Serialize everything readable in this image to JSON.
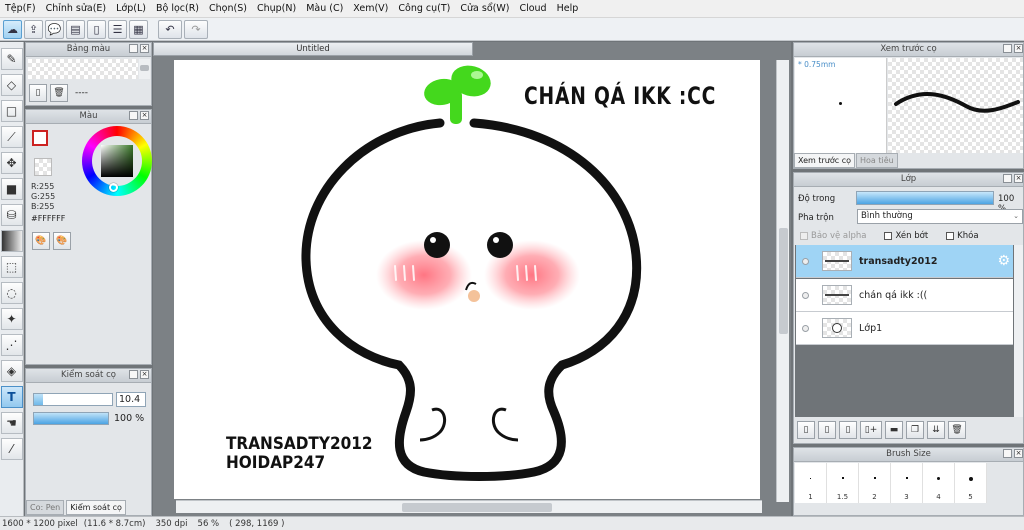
{
  "menu": [
    "Tệp(F)",
    "Chỉnh sửa(E)",
    "Lớp(L)",
    "Bộ lọc(R)",
    "Chọn(S)",
    "Chụp(N)",
    "Màu (C)",
    "Xem(V)",
    "Công cụ(T)",
    "Cửa sổ(W)",
    "Cloud",
    "Help"
  ],
  "toolbar_icons": [
    "cloud-icon",
    "export-icon",
    "comment-icon",
    "gallery-icon",
    "page-icon",
    "layout-icon",
    "grid-icon",
    "undo-icon",
    "redo-icon"
  ],
  "tools": [
    "brush-icon",
    "eraser-icon",
    "rectangle-icon",
    "line-icon",
    "move-icon",
    "fill-shape-icon",
    "bucket-icon",
    "gradient-icon",
    "select-rect-icon",
    "lasso-icon",
    "magic-wand-icon",
    "select-pen-icon",
    "select-eraser-icon",
    "text-icon",
    "hand-icon",
    "eyedropper-icon"
  ],
  "palette_panel": {
    "title": "Bảng màu",
    "info": "----"
  },
  "color_panel": {
    "title": "Màu",
    "primary": "#cc2222",
    "r": "R:255",
    "g": "G:255",
    "b": "B:255",
    "hex": "#FFFFFF"
  },
  "control_panel": {
    "title": "Kiểm soát cọ",
    "size_value": "10.4",
    "size_fraction": 0.12,
    "opacity_value": "100 %",
    "opacity_fraction": 1.0,
    "tabs": [
      "Co: Pen",
      "Kiểm soát cọ"
    ]
  },
  "document": {
    "tab_title": "Untitled",
    "heading_text": "CHÁN QÁ IKK :CC",
    "credit_line1": "TRANSADTY2012",
    "credit_line2": "HOIDAP247"
  },
  "preview_panel": {
    "title": "Xem trước cọ",
    "size_label": "* 0.75mm",
    "tabs": [
      "Xem trước cọ",
      "Hoa tiêu"
    ]
  },
  "layer_panel": {
    "title": "Lớp",
    "opacity_label": "Độ trong",
    "opacity_value": "100 %",
    "opacity_fraction": 1.0,
    "blend_label": "Pha trộn",
    "blend_value": "Bình thường",
    "protect_alpha": "Bảo vệ alpha",
    "clipping": "Xén bớt",
    "lock": "Khóa",
    "layers": [
      {
        "name": "transadty2012",
        "selected": true
      },
      {
        "name": "chán qá ikk :((",
        "selected": false
      },
      {
        "name": "Lớp1",
        "selected": false
      }
    ]
  },
  "brush_size_panel": {
    "title": "Brush Size",
    "sizes": [
      "1",
      "1.5",
      "2",
      "3",
      "4",
      "5"
    ]
  },
  "status": {
    "dimensions": "1600 * 1200 pixel",
    "physical": "(11.6 * 8.7cm)",
    "dpi": "350 dpi",
    "zoom": "56 %",
    "cursor": "( 298, 1169 )"
  },
  "colors": {
    "accent": "#4ba3e3",
    "sprout": "#4ee020",
    "blush": "#ff7b86"
  }
}
